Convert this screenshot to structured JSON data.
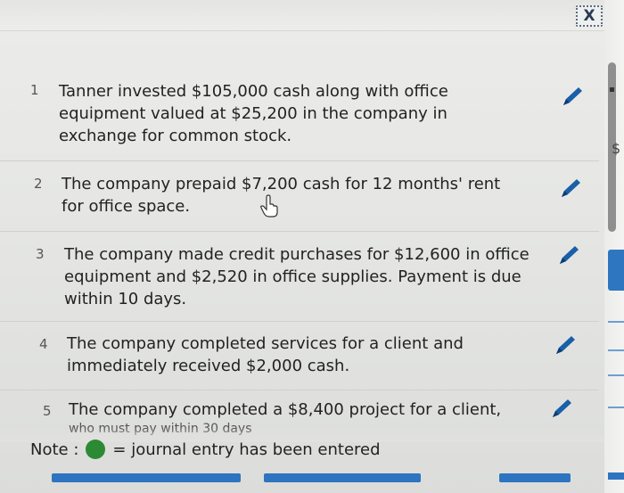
{
  "window": {
    "close_label": "X"
  },
  "items": [
    {
      "num": "1",
      "text_lines": [
        "Tanner invested $105,000 cash along with office",
        "equipment valued at $25,200 in the company in",
        "exchange for common stock."
      ]
    },
    {
      "num": "2",
      "text_lines": [
        "The company prepaid $7,200 cash for 12 months' rent",
        "for office space."
      ]
    },
    {
      "num": "3",
      "text_lines": [
        "The company made credit purchases for $12,600 in office",
        "equipment and $2,520 in office supplies. Payment is due",
        "within 10 days."
      ]
    },
    {
      "num": "4",
      "text_lines": [
        "The company completed services for a client and",
        "immediately received $2,000 cash."
      ]
    },
    {
      "num": "5",
      "text_lines": [
        "The company completed a $8,400 project for a client,",
        "who must pay within 30 days"
      ]
    }
  ],
  "side": {
    "dollar": "$"
  },
  "note": {
    "label": "Note :",
    "text": "= journal entry has been entered"
  },
  "colors": {
    "pencil": "#1a5fa8",
    "entered": "#2c8a34",
    "accent": "#2e74c0"
  }
}
